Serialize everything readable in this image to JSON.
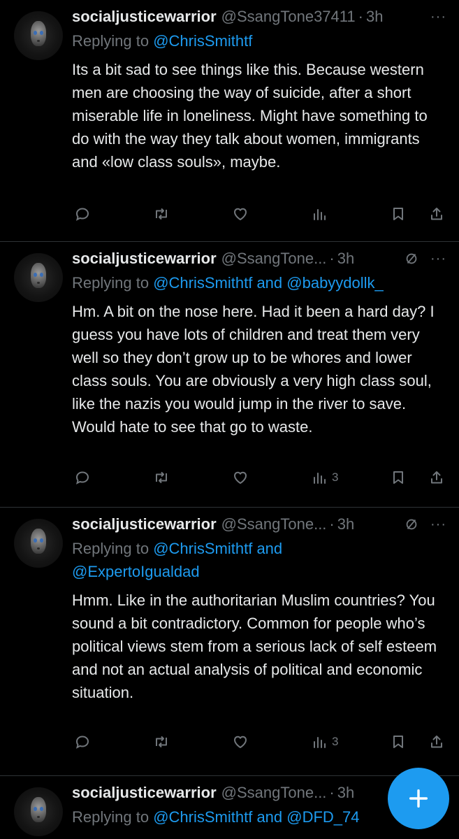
{
  "tweets": [
    {
      "name": "socialjusticewarrior",
      "handle": "@SsangTone37411",
      "dot": "·",
      "time": "3h",
      "more": "···",
      "replying_prefix": "Replying to",
      "mentions": "@ChrisSmithtf",
      "mentions2": "",
      "text": "Its a bit sad to see things like this. Because western men are choosing the way of suicide, after a short miserable life in loneliness. Might have something to do with the way they talk about women, immigrants and «low class souls», maybe.",
      "views": ""
    },
    {
      "name": "socialjusticewarrior",
      "handle": "@SsangTone...",
      "dot": "·",
      "time": "3h",
      "more": "···",
      "replying_prefix": "Replying to",
      "mentions": "@ChrisSmithtf and @babyydollk_",
      "mentions2": "",
      "text": "Hm. A bit on the nose here. Had it been a hard day? I guess you have lots of children and treat them very well so they don’t grow up to be whores and lower class souls. You are obviously a very high class soul, like the nazis you would jump in the river to save. Would hate to see that go to waste.",
      "views": "3"
    },
    {
      "name": "socialjusticewarrior",
      "handle": "@SsangTone...",
      "dot": "·",
      "time": "3h",
      "more": "···",
      "replying_prefix": "Replying to",
      "mentions": "@ChrisSmithtf and",
      "mentions2": "@ExpertoIgualdad",
      "text": "Hmm. Like in the authoritarian Muslim countries? You sound a bit contradictory. Common for people who’s political views stem from a serious lack of self esteem and not an actual analysis of political and economic situation.",
      "views": "3"
    },
    {
      "name": "socialjusticewarrior",
      "handle": "@SsangTone...",
      "dot": "·",
      "time": "3h",
      "more": "",
      "replying_prefix": "Replying to",
      "mentions": "@ChrisSmithtf and @DFD_74",
      "mentions2": "",
      "text": "",
      "views": ""
    }
  ],
  "icons": {
    "reply": "reply-icon",
    "retweet": "retweet-icon",
    "like": "heart-icon",
    "views": "views-icon",
    "bookmark": "bookmark-icon",
    "share": "share-icon",
    "muted": "muted-icon",
    "compose": "compose-plus-icon"
  },
  "colors": {
    "background": "#000000",
    "text": "#e7e9ea",
    "secondary": "#71767b",
    "accent": "#1d9bf0",
    "divider": "#2f3336"
  }
}
